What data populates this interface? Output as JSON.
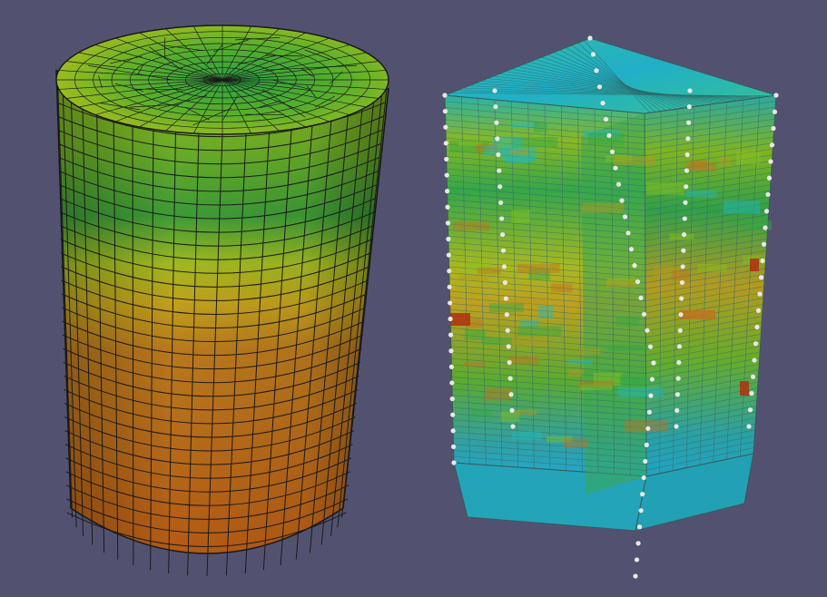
{
  "viewport": {
    "background": "#525270",
    "objects": [
      {
        "name": "cylinder-mesh",
        "kind": "hex-mesh cylinder",
        "edge_color": "#1a1a1a",
        "colormap": [
          "#2aa59a",
          "#20a040",
          "#7ec21a",
          "#c8c818",
          "#c87a1a",
          "#b05a14"
        ]
      },
      {
        "name": "box-mesh-cutaway",
        "kind": "clipped hex-mesh block with well trajectories",
        "edge_color": "#3a5a5a",
        "colormap": [
          "#20b8c0",
          "#30a850",
          "#88c020",
          "#c0b020",
          "#c07020",
          "#b03010"
        ],
        "marker_color": "#e8e8e8"
      }
    ]
  }
}
